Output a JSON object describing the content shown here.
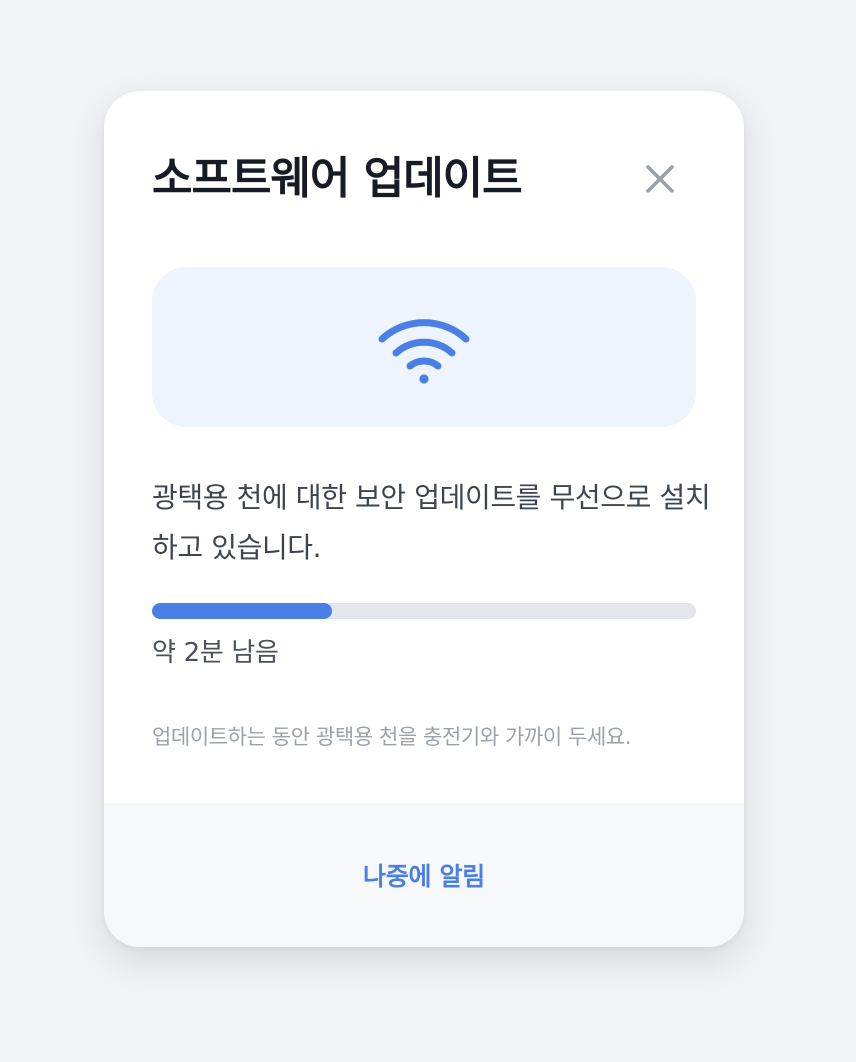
{
  "dialog": {
    "title": "소프트웨어 업데이트",
    "close_icon": "close-icon",
    "hero_icon": "wifi-icon",
    "description": "광택용 천에 대한 보안 업데이트를 무선으로 설치하고 있습니다.",
    "progress": {
      "fraction": 0.33,
      "remaining_text": "약 2분 남음"
    },
    "hint": "업데이트하는 동안 광택용 천을 충전기와 가까이 두세요.",
    "later_button": "나중에 알림"
  },
  "colors": {
    "accent": "#4a7fe6",
    "hero_background": "#edf4fe",
    "page_background": "#f2f3f5",
    "close_icon": "#9aa0aa",
    "track": "#e4e6eb"
  }
}
